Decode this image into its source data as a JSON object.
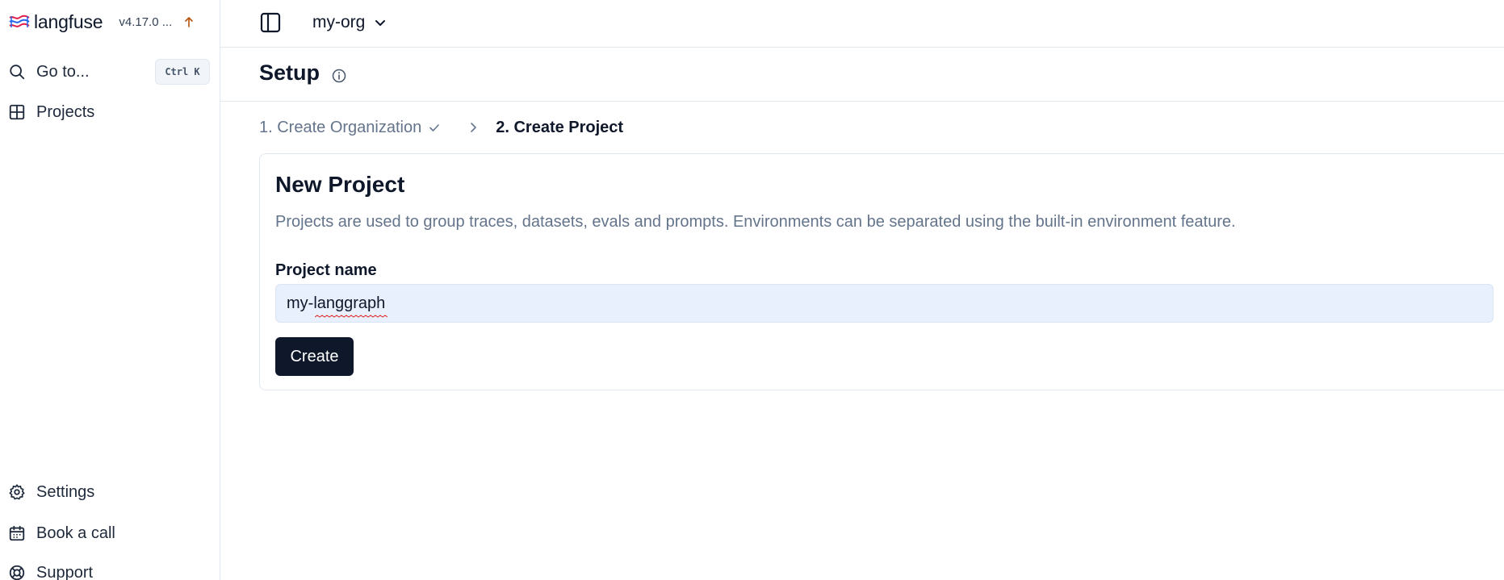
{
  "sidebar": {
    "brand": {
      "name": "langfuse",
      "version": "v4.17.0 ..."
    },
    "goto": {
      "label": "Go to...",
      "shortcut": "Ctrl K"
    },
    "projects_label": "Projects",
    "bottom_items": [
      {
        "label": "Settings",
        "icon": "gear-icon"
      },
      {
        "label": "Book a call",
        "icon": "calendar-icon"
      },
      {
        "label": "Support",
        "icon": "lifebuoy-icon"
      }
    ]
  },
  "topbar": {
    "org_name": "my-org"
  },
  "setup": {
    "title": "Setup",
    "steps": [
      {
        "label": "1. Create Organization",
        "status": "done"
      },
      {
        "label": "2. Create Project",
        "status": "current"
      }
    ]
  },
  "card": {
    "title": "New Project",
    "description": "Projects are used to group traces, datasets, evals and prompts. Environments can be separated using the built-in environment feature.",
    "field_label": "Project name",
    "field_value": "my-langgraph",
    "submit_label": "Create"
  },
  "colors": {
    "primary": "#0f172a",
    "muted_text": "#64748b",
    "border": "#e2e8f0",
    "input_bg": "#e8f0fe",
    "upgrade_arrow": "#b45309"
  }
}
